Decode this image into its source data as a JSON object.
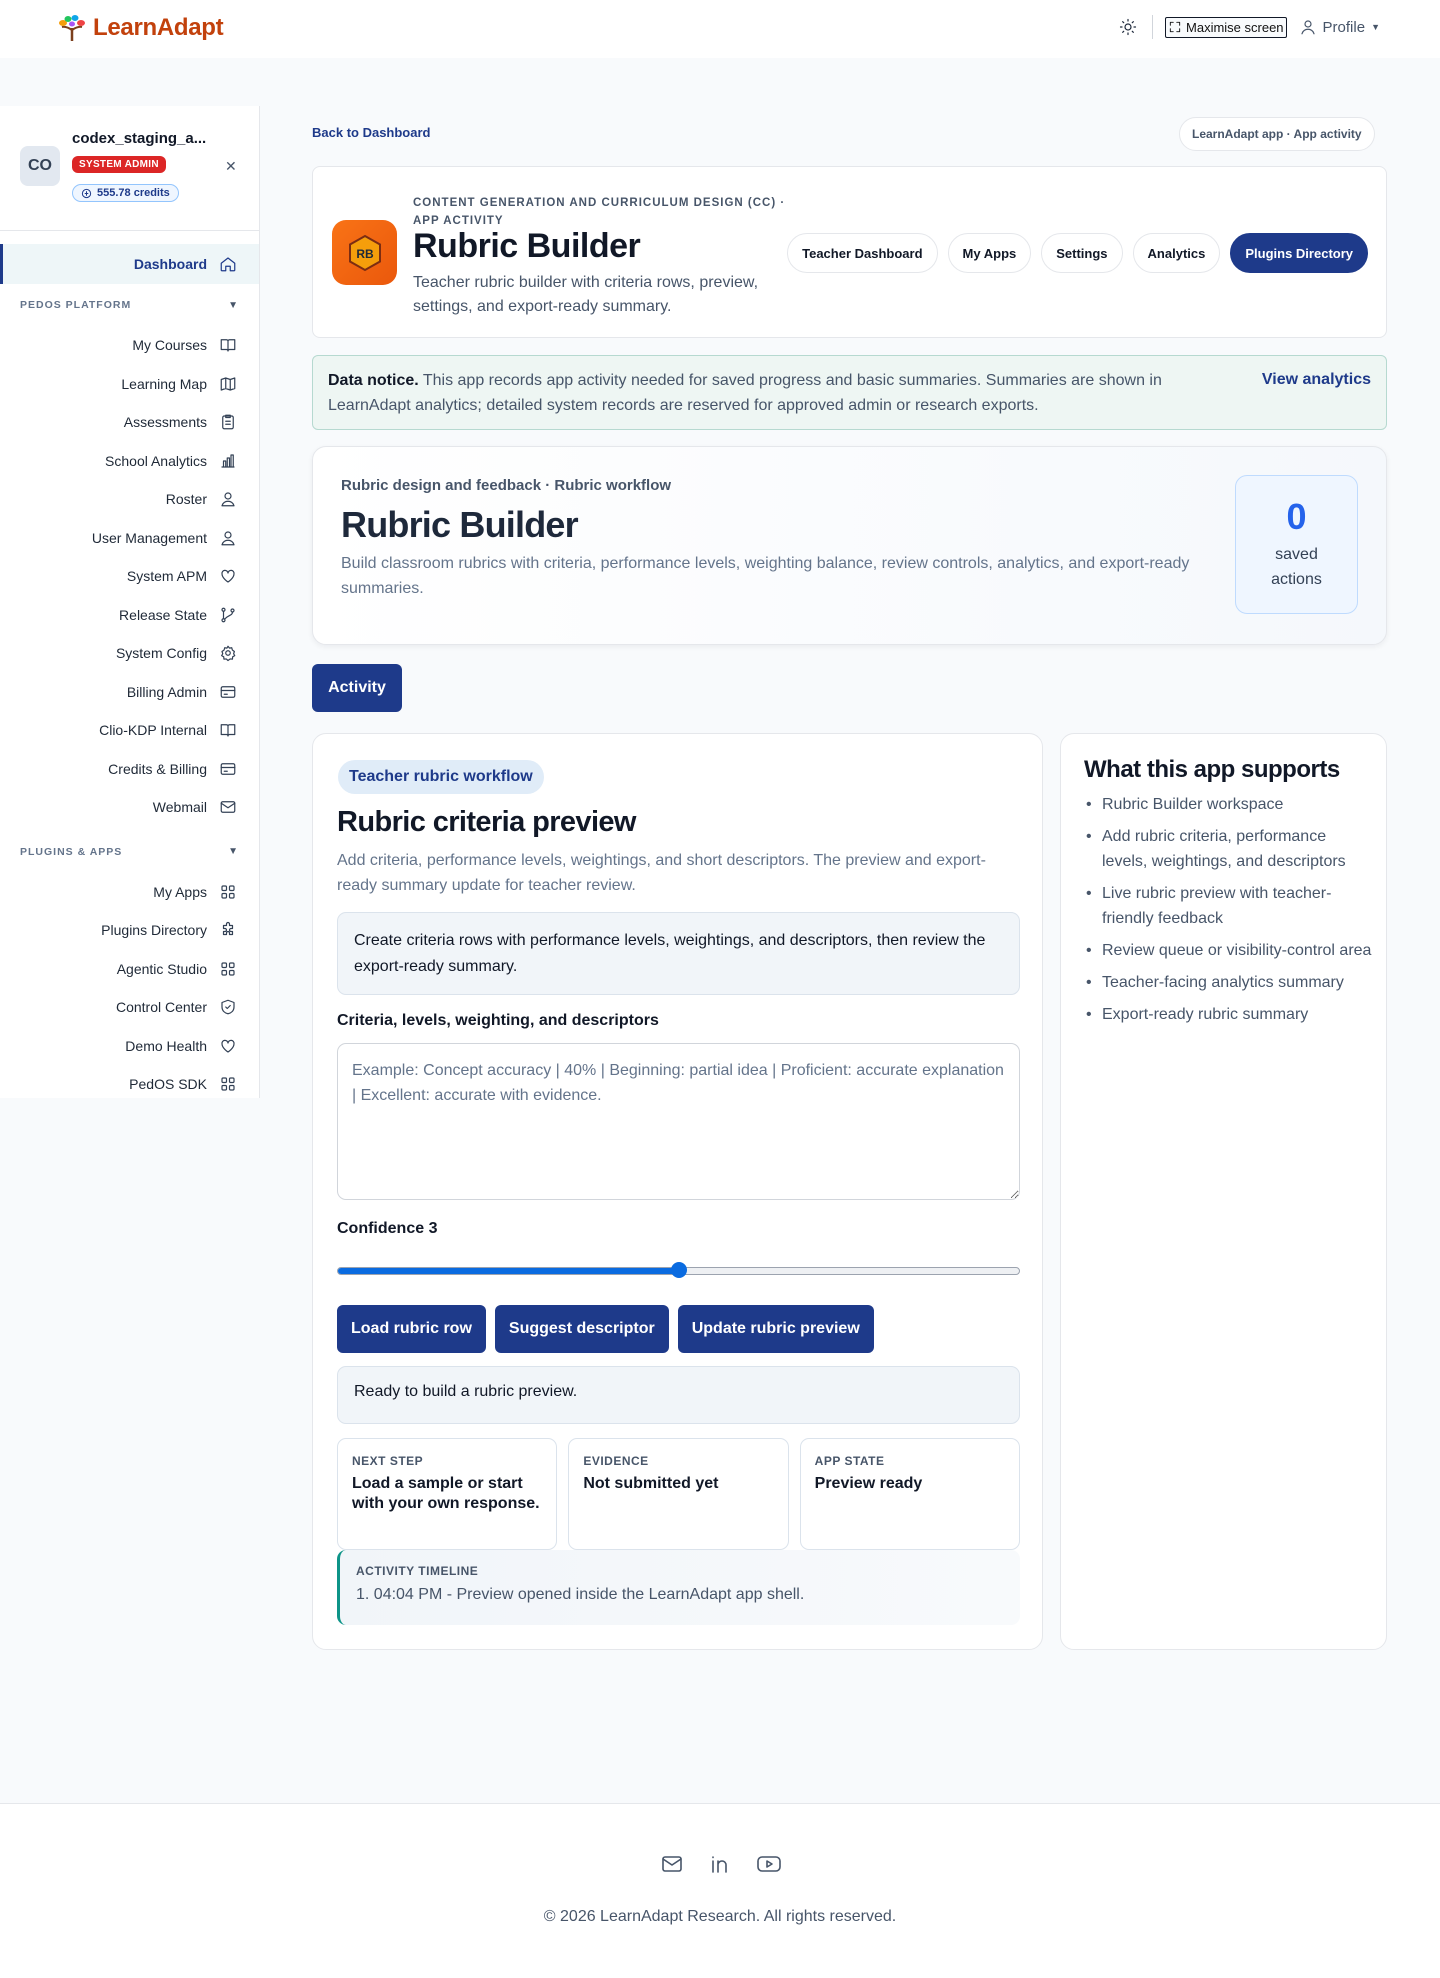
{
  "brand": {
    "name": "LearnAdapt"
  },
  "topbar": {
    "maximise_label": "Maximise screen",
    "profile_label": "Profile"
  },
  "user": {
    "initials": "CO",
    "name": "codex_staging_a...",
    "role": "SYSTEM ADMIN",
    "credits": "555.78 credits"
  },
  "sidebar": {
    "dashboard": "Dashboard",
    "section1_title": "PEDOS PLATFORM",
    "section1_items": [
      {
        "label": "My Courses",
        "icon": "book-icon"
      },
      {
        "label": "Learning Map",
        "icon": "map-icon"
      },
      {
        "label": "Assessments",
        "icon": "clipboard-icon"
      },
      {
        "label": "School Analytics",
        "icon": "bar-chart-icon"
      },
      {
        "label": "Roster",
        "icon": "users-icon"
      },
      {
        "label": "User Management",
        "icon": "users-icon"
      },
      {
        "label": "System APM",
        "icon": "heart-icon"
      },
      {
        "label": "Release State",
        "icon": "git-branch-icon"
      },
      {
        "label": "System Config",
        "icon": "gear-icon"
      },
      {
        "label": "Billing Admin",
        "icon": "credit-card-icon"
      },
      {
        "label": "Clio-KDP Internal",
        "icon": "book-icon"
      },
      {
        "label": "Credits & Billing",
        "icon": "credit-card-icon"
      },
      {
        "label": "Webmail",
        "icon": "mail-icon"
      }
    ],
    "section2_title": "PLUGINS & APPS",
    "section2_items": [
      {
        "label": "My Apps",
        "icon": "grid-icon"
      },
      {
        "label": "Plugins Directory",
        "icon": "puzzle-icon"
      },
      {
        "label": "Agentic Studio",
        "icon": "grid-icon"
      },
      {
        "label": "Control Center",
        "icon": "shield-icon"
      },
      {
        "label": "Demo Health",
        "icon": "heart-icon"
      },
      {
        "label": "PedOS SDK",
        "icon": "grid-icon"
      }
    ]
  },
  "main": {
    "back_link": "Back to Dashboard",
    "breadcrumb": "LearnAdapt app · App activity",
    "header": {
      "app_icon_text": "RB",
      "eyebrow": "CONTENT GENERATION AND CURRICULUM DESIGN (CC) · APP ACTIVITY",
      "title": "Rubric Builder",
      "description": "Teacher rubric builder with criteria rows, preview, settings, and export-ready summary.",
      "tabs": [
        "Teacher Dashboard",
        "My Apps",
        "Settings",
        "Analytics",
        "Plugins Directory"
      ]
    },
    "notice": {
      "bold": "Data notice.",
      "text": " This app records app activity needed for saved progress and basic summaries. Summaries are shown in LearnAdapt analytics; detailed system records are reserved for approved admin or research exports.",
      "link": "View analytics"
    },
    "hero": {
      "eyebrow": "Rubric design and feedback · Rubric workflow",
      "title": "Rubric Builder",
      "description": "Build classroom rubrics with criteria, performance levels, weighting balance, review controls, analytics, and export-ready summaries.",
      "stat_value": "0",
      "stat_label": "saved actions"
    },
    "activity_button": "Activity",
    "workflow": {
      "pill": "Teacher rubric workflow",
      "title": "Rubric criteria preview",
      "description": "Add criteria, performance levels, weightings, and short descriptors. The preview and export-ready summary update for teacher review.",
      "instructions": "Create criteria rows with performance levels, weightings, and descriptors, then review the export-ready summary.",
      "field_label": "Criteria, levels, weighting, and descriptors",
      "field_placeholder": "Example: Concept accuracy | 40% | Beginning: partial idea | Proficient: accurate explanation | Excellent: accurate with evidence.",
      "confidence_label": "Confidence 3",
      "confidence_fraction": 0.5,
      "buttons": [
        "Load rubric row",
        "Suggest descriptor",
        "Update rubric preview"
      ],
      "status": "Ready to build a rubric preview.",
      "cards": [
        {
          "label": "NEXT STEP",
          "value": "Load a sample or start with your own response."
        },
        {
          "label": "EVIDENCE",
          "value": "Not submitted yet"
        },
        {
          "label": "APP STATE",
          "value": "Preview ready"
        }
      ],
      "timeline_label": "ACTIVITY TIMELINE",
      "timeline_item": "1. 04:04 PM - Preview opened inside the LearnAdapt app shell."
    },
    "support": {
      "title": "What this app supports",
      "items": [
        "Rubric Builder workspace",
        "Add rubric criteria, performance levels, weightings, and descriptors",
        "Live rubric preview with teacher-friendly feedback",
        "Review queue or visibility-control area",
        "Teacher-facing analytics summary",
        "Export-ready rubric summary"
      ]
    }
  },
  "footer": {
    "copyright": "© 2026 LearnAdapt Research. All rights reserved."
  },
  "colors": {
    "primary": "#1e3a8a",
    "danger": "#dc2626",
    "accent": "#0a6be0",
    "brand": "#c2410c"
  }
}
